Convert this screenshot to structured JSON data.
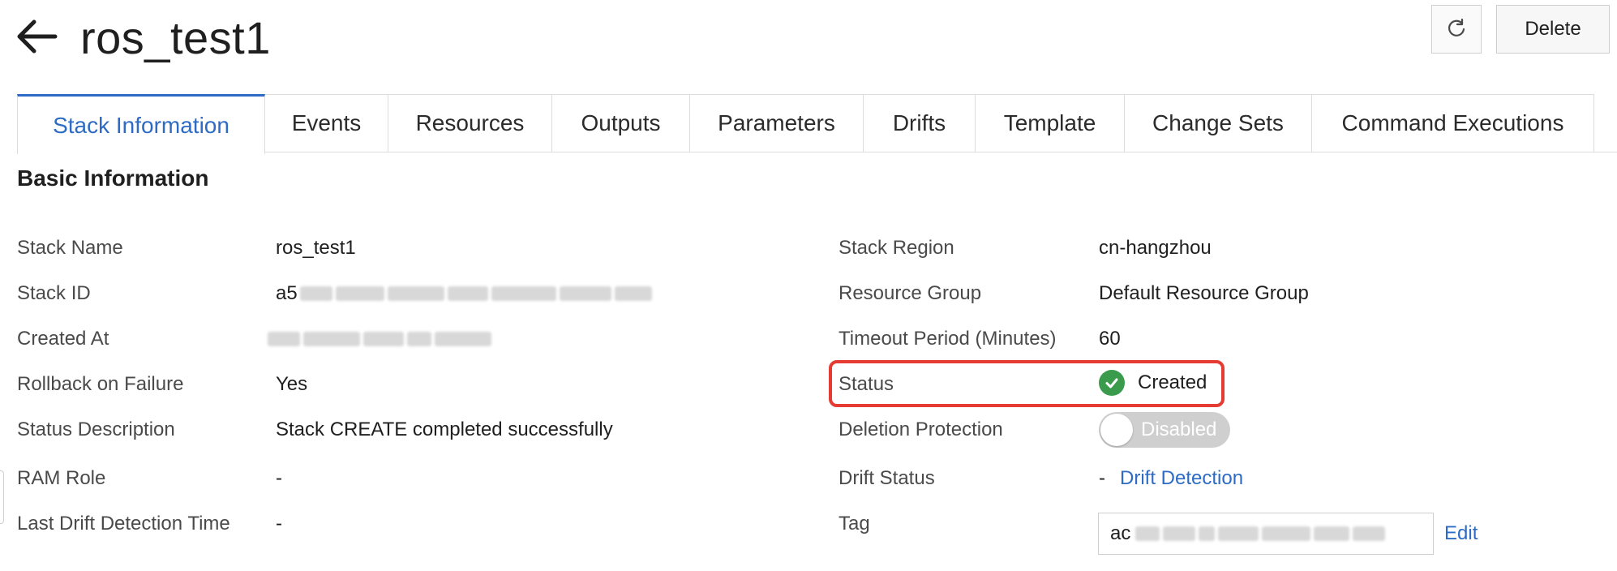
{
  "header": {
    "title": "ros_test1",
    "delete_label": "Delete"
  },
  "tabs": [
    {
      "label": "Stack Information",
      "active": true
    },
    {
      "label": "Events"
    },
    {
      "label": "Resources"
    },
    {
      "label": "Outputs"
    },
    {
      "label": "Parameters"
    },
    {
      "label": "Drifts"
    },
    {
      "label": "Template"
    },
    {
      "label": "Change Sets"
    },
    {
      "label": "Command Executions"
    }
  ],
  "section": {
    "title": "Basic Information"
  },
  "left_fields": [
    {
      "label": "Stack Name",
      "value": "ros_test1"
    },
    {
      "label": "Stack ID",
      "value": "a5"
    },
    {
      "label": "Created At",
      "value": ""
    },
    {
      "label": "Rollback on Failure",
      "value": "Yes"
    },
    {
      "label": "Status Description",
      "value": "Stack CREATE completed successfully"
    },
    {
      "label": "RAM Role",
      "value": "-"
    },
    {
      "label": "Last Drift Detection Time",
      "value": "-"
    }
  ],
  "right_fields": {
    "region": {
      "label": "Stack Region",
      "value": "cn-hangzhou"
    },
    "resource_group": {
      "label": "Resource Group",
      "value": "Default Resource Group"
    },
    "timeout": {
      "label": "Timeout Period (Minutes)",
      "value": "60"
    },
    "status": {
      "label": "Status",
      "value": "Created"
    },
    "deletion_protection": {
      "label": "Deletion Protection",
      "value": "Disabled"
    },
    "drift_status": {
      "label": "Drift Status",
      "value": "-",
      "link": "Drift Detection"
    },
    "tag": {
      "label": "Tag",
      "value": "ac",
      "edit_label": "Edit"
    }
  },
  "colors": {
    "accent": "#2d6bc4",
    "success": "#3a9b4d",
    "highlight": "#e53b32"
  },
  "icons": {
    "back": "arrow-left-icon",
    "refresh": "refresh-icon",
    "status": "check-circle-icon"
  }
}
